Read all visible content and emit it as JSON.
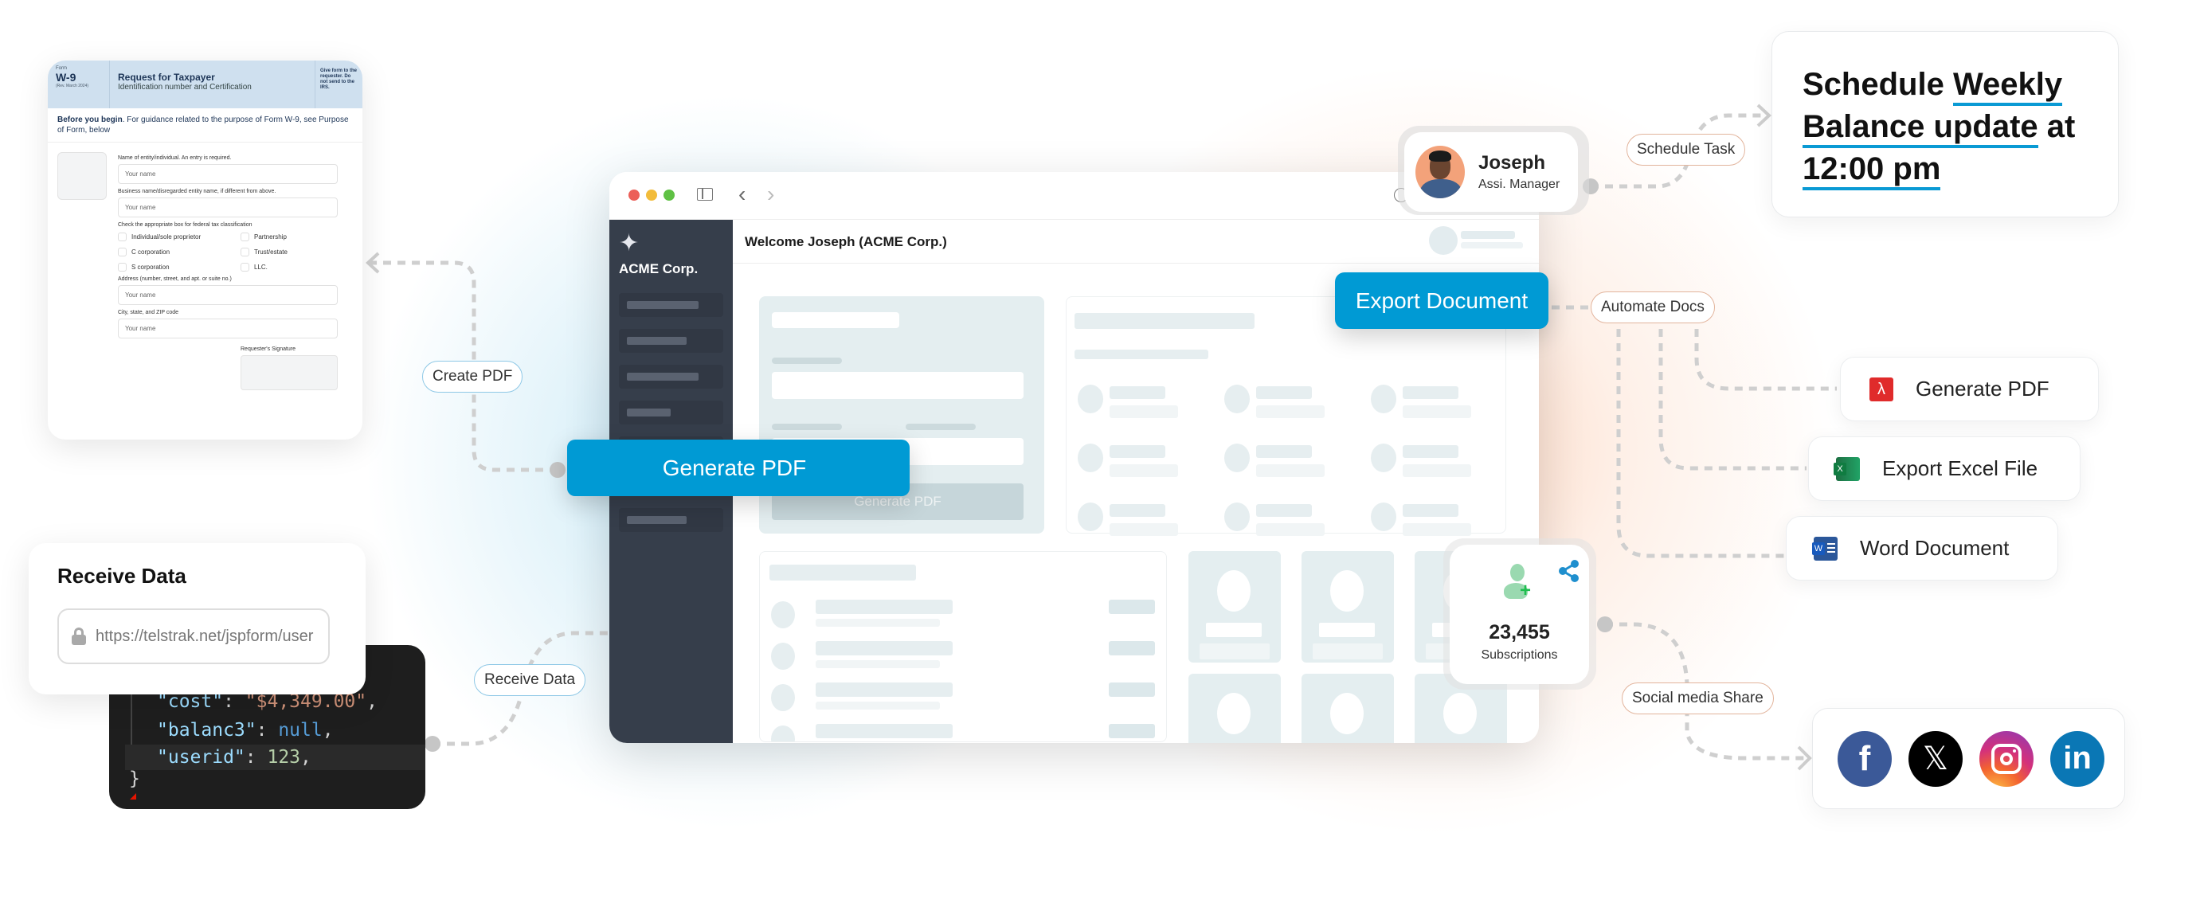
{
  "colors": {
    "accent_blue": "#009ad4",
    "sidebar_dark": "#363e4b",
    "pdf_red": "#e02b2b",
    "excel_green": "#107c41",
    "word_blue": "#2b579a",
    "facebook": "#3b5998",
    "linkedin": "#0a77b5"
  },
  "w9_form": {
    "form_label": "Form",
    "form_number": "W-9",
    "revision": "(Rev. March 2024)",
    "title": "Request for Taxpayer",
    "subtitle": "Identification number and Certification",
    "side_note": "Give form to the requester. Do not send to the IRS.",
    "before_begin_bold": "Before you begin",
    "before_begin_text": ". For guidance related to the purpose of Form W-9, see Purpose of Form, below",
    "fields": [
      {
        "label": "Name of entity/individual. An entry is required.",
        "placeholder": "Your name"
      },
      {
        "label": "Business name/disregarded entity name, if different from above.",
        "placeholder": "Your name"
      }
    ],
    "classification_label": "Check the appropriate box for federal tax classification",
    "classifications": [
      "Individual/sole proprietor",
      "Partnership",
      "C corporation",
      "Trust/estate",
      "S corporation",
      "LLC."
    ],
    "address_fields": [
      {
        "label": "Address (number, street, and apt. or suite no.)",
        "placeholder": "Your name"
      },
      {
        "label": "City, state, and ZIP code",
        "placeholder": "Your name"
      }
    ],
    "signature_label": "Requester's Signature"
  },
  "receive_data_card": {
    "title": "Receive Data",
    "url": "https://telstrak.net/jspform/user",
    "icon": "lock-icon"
  },
  "code_snippet": {
    "lines": [
      {
        "key": "\"cost\"",
        "value": "\"$4,349.00\"",
        "type": "string"
      },
      {
        "key": "\"balanc3\"",
        "value": "null",
        "type": "null"
      },
      {
        "key": "\"userid\"",
        "value": "123",
        "type": "number"
      }
    ],
    "closing": "}"
  },
  "browser": {
    "brand": "ACME Corp.",
    "welcome": "Welcome Joseph (ACME Corp.)",
    "inner_button": "Generate PDF"
  },
  "buttons": {
    "generate_pdf": "Generate PDF",
    "export_document": "Export Document"
  },
  "user_card": {
    "name": "Joseph",
    "role": "Assi. Manager"
  },
  "subscriptions_card": {
    "count": "23,455",
    "label": "Subscriptions"
  },
  "pills": {
    "create_pdf": "Create PDF",
    "receive_data": "Receive Data",
    "schedule_task": "Schedule Task",
    "automate_docs": "Automate Docs",
    "social_share": "Social media Share"
  },
  "schedule_card": {
    "word1": "Schedule",
    "underlined1": "Weekly",
    "underlined2": "Balance update",
    "word2": "at",
    "underlined3": "12:00 pm"
  },
  "actions": [
    {
      "label": "Generate PDF",
      "icon": "pdf-icon"
    },
    {
      "label": "Export Excel File",
      "icon": "excel-icon"
    },
    {
      "label": "Word Document",
      "icon": "word-icon"
    }
  ],
  "social_networks": [
    "facebook",
    "x",
    "instagram",
    "linkedin"
  ]
}
